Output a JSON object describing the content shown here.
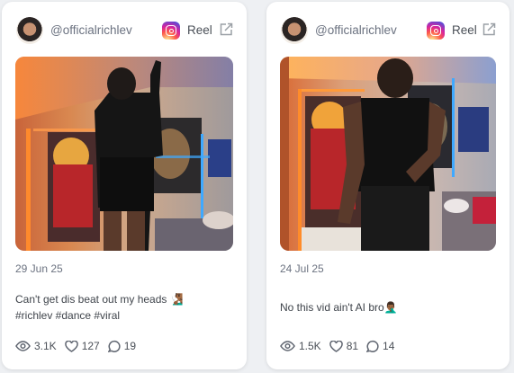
{
  "cards": [
    {
      "handle": "@officialrichlev",
      "platform_label": "Reel",
      "platform_icon": "instagram-icon",
      "date": "29 Jun 25",
      "caption_lines": [
        "Can't get dis beat out my heads 🧏🏾‍♂️",
        "#richlev #dance #viral"
      ],
      "stats": {
        "views": "3.1K",
        "likes": "127",
        "comments": "19"
      }
    },
    {
      "handle": "@officialrichlev",
      "platform_label": "Reel",
      "platform_icon": "instagram-icon",
      "date": "24 Jul 25",
      "caption_lines": [
        "No this vid ain't AI bro🤦🏾‍♂️"
      ],
      "stats": {
        "views": "1.5K",
        "likes": "81",
        "comments": "14"
      }
    }
  ],
  "colors": {
    "instagram_gradient": [
      "#fdf497",
      "#fd5949",
      "#d6249f",
      "#285aeb"
    ],
    "led_orange": "#ff7a2a",
    "led_blue": "#4aa8ff"
  }
}
